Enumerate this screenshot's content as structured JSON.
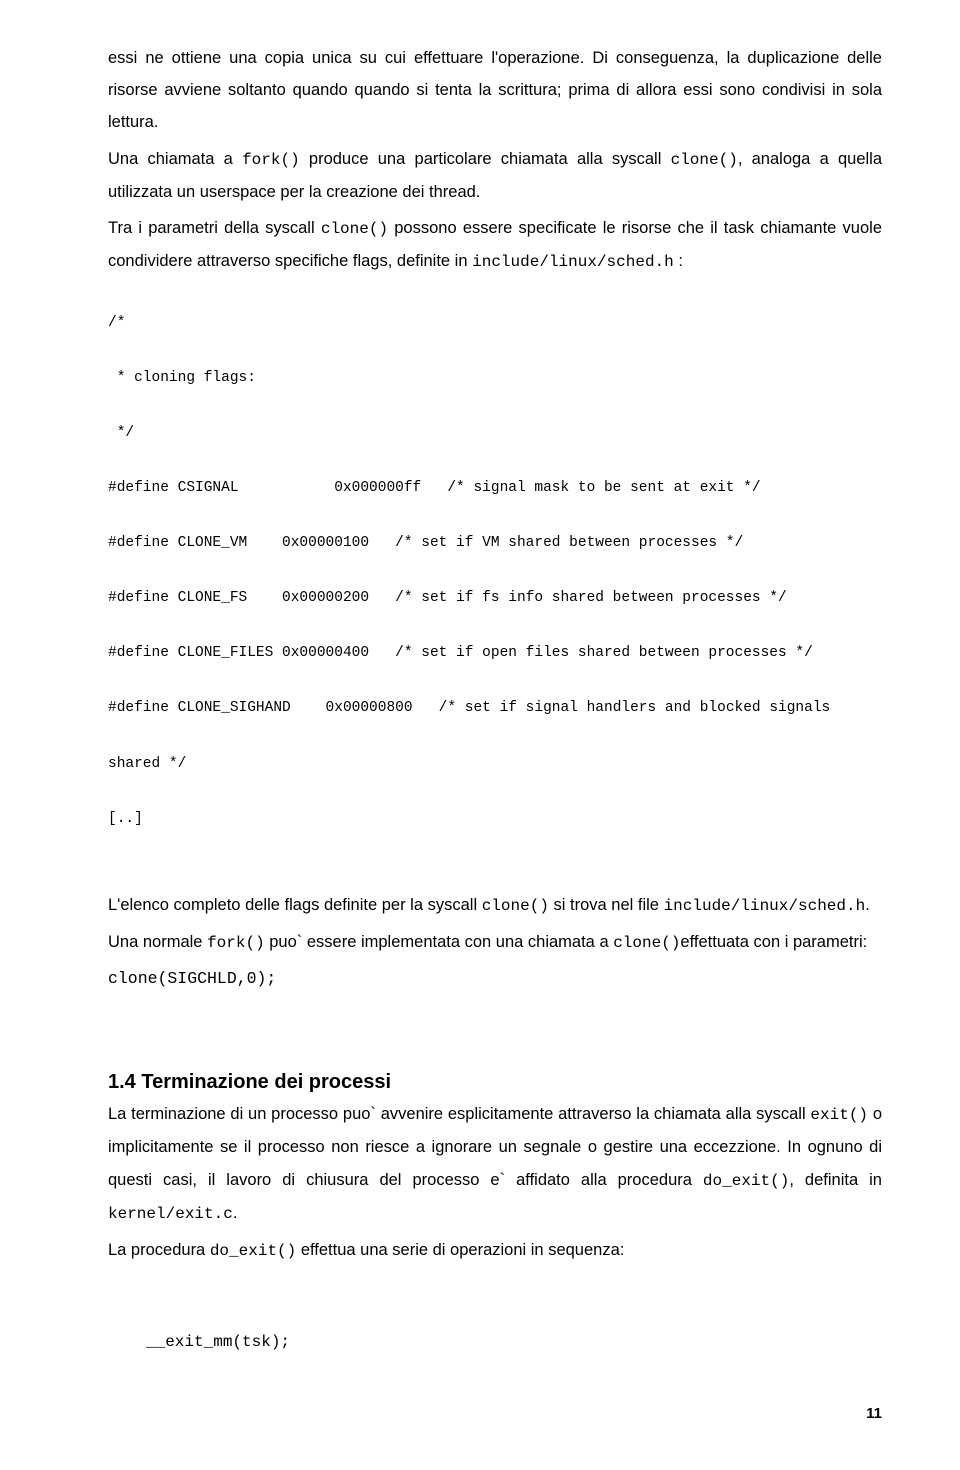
{
  "para1": "essi ne ottiene una copia unica su cui effettuare l'operazione. Di conseguenza, la duplicazione delle risorse avviene soltanto quando quando si tenta la scrittura; prima di allora essi sono condivisi in sola lettura.",
  "para2a": "Una chiamata a ",
  "para2code1": "fork()",
  "para2b": " produce una particolare chiamata alla syscall ",
  "para2code2": "clone()",
  "para2c": ", analoga a quella utilizzata un userspace per la creazione dei thread.",
  "para3a": "Tra i parametri della syscall ",
  "para3code1": "clone()",
  "para3b": " possono essere specificate le risorse che il task chiamante vuole condividere attraverso specifiche flags, definite in ",
  "para3code2": "include/linux/sched.h",
  "para3c": " :",
  "codeblock_line1": "/*",
  "codeblock_line2": " * cloning flags:",
  "codeblock_line3": " */",
  "codeblock_line4": "#define CSIGNAL           0x000000ff   /* signal mask to be sent at exit */",
  "codeblock_line5": "#define CLONE_VM    0x00000100   /* set if VM shared between processes */",
  "codeblock_line6": "#define CLONE_FS    0x00000200   /* set if fs info shared between processes */",
  "codeblock_line7": "#define CLONE_FILES 0x00000400   /* set if open files shared between processes */",
  "codeblock_just_a": "#define CLONE_SIGHAND",
  "codeblock_just_b": "0x00000800",
  "codeblock_just_c": "/* set if signal handlers and blocked signals",
  "codeblock_line9": "shared */",
  "codeblock_line10": "[..]",
  "para4a": "L'elenco completo delle flags definite per la syscall ",
  "para4code1": "clone()",
  "para4b": " si trova nel file ",
  "para4code2": "include/linux/sched.h",
  "para4c": ".",
  "para5a": "Una normale ",
  "para5code1": "fork()",
  "para5b": " puo` essere implementata con una chiamata a ",
  "para5code2": "clone()",
  "para5c": "effettuata con i parametri:",
  "para6code": "clone(SIGCHLD,0);",
  "heading": "1.4 Terminazione dei processi",
  "para7a": "La terminazione di un processo puo` avvenire esplicitamente attraverso la chiamata alla syscall ",
  "para7code1": "exit()",
  "para7b": " o implicitamente se il processo non riesce a ignorare un segnale o gestire una eccezzione. In ognuno di questi casi, il lavoro di chiusura del processo e` affidato alla procedura ",
  "para7code2": "do_exit()",
  "para7c": ", definita in ",
  "para7code3": "kernel/exit.c",
  "para7d": ".",
  "para8a": "La procedura ",
  "para8code1": "do_exit()",
  "para8b": " effettua una serie di operazioni in sequenza:",
  "exitline": "__exit_mm(tsk);",
  "page_number": "11"
}
